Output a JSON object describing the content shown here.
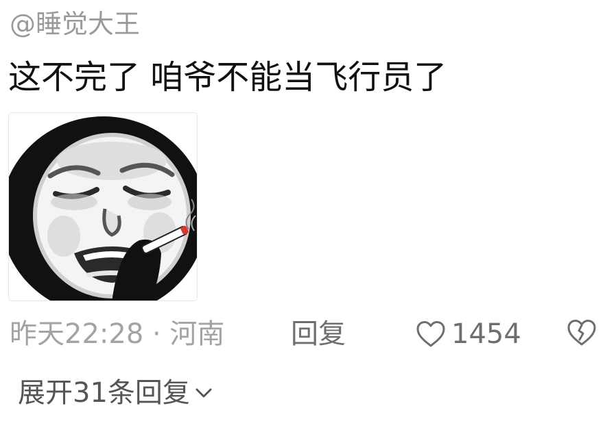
{
  "comment": {
    "username": "@睡觉大王",
    "text": "这不完了 咱爷不能当飞行员了",
    "sticker_icon": "panda-crying-smoking-sticker",
    "meta": "昨天22:28 · 河南",
    "reply_label": "回复",
    "like_icon": "heart-outline-icon",
    "like_count": "1454",
    "dislike_icon": "broken-heart-icon"
  },
  "replies": {
    "expand_label": "展开31条回复",
    "expand_icon": "chevron-down-icon"
  },
  "colors": {
    "text_primary": "#111111",
    "text_secondary": "#9a9a9a",
    "action": "#6e6e6e"
  }
}
